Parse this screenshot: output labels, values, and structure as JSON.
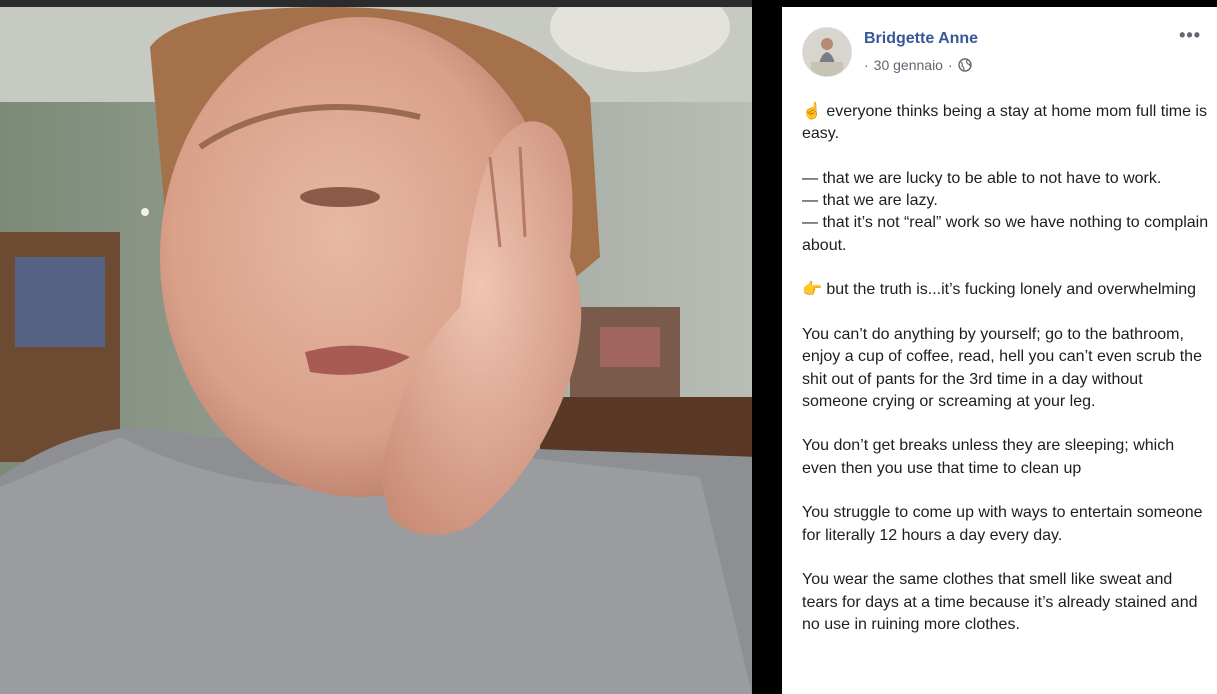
{
  "post": {
    "author": "Bridgette Anne",
    "date_prefix": "·",
    "date": "30 gennaio",
    "date_suffix": "·",
    "more_label": "•••",
    "paragraphs": [
      {
        "emoji": "☝️",
        "text": " everyone thinks being a stay at home mom full time is easy."
      },
      {
        "emoji": "",
        "text": "— that we are lucky to be able to not have to work.\n— that we are lazy.\n— that it’s not “real” work so we have nothing to complain about."
      },
      {
        "emoji": "👉",
        "text": " but the truth is...it’s fucking lonely and overwhelming"
      },
      {
        "emoji": "",
        "text": "You can’t do anything by yourself; go to the bathroom, enjoy a cup of coffee, read, hell you can’t even scrub the shit out of pants for the 3rd time in a day without someone crying or screaming at your leg."
      },
      {
        "emoji": "",
        "text": "You don’t get breaks unless they are sleeping; which even then you use that time to clean up"
      },
      {
        "emoji": "",
        "text": "You struggle to come up with ways to entertain someone for literally 12 hours a day every day."
      },
      {
        "emoji": "",
        "text": "You wear the same clothes that smell like sweat and tears for days at a time because it’s already stained and no use in ruining more clothes."
      }
    ]
  },
  "colors": {
    "author_link": "#365899",
    "meta_text": "#616770",
    "body_text": "#1c1e21"
  },
  "icons": {
    "privacy": "globe-icon",
    "options": "more-options-icon"
  }
}
